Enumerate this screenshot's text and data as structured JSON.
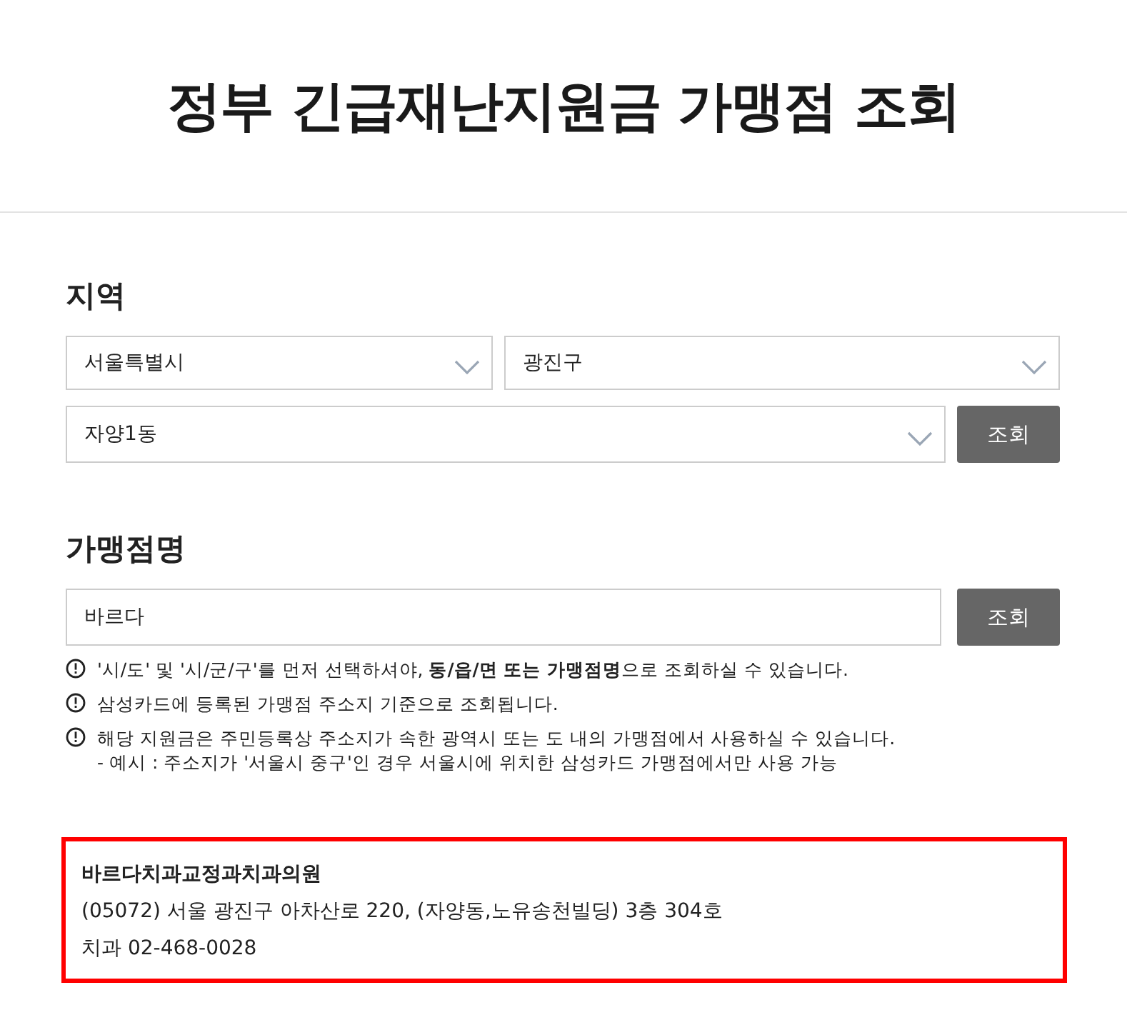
{
  "title": "정부 긴급재난지원금 가맹점 조회",
  "region": {
    "heading": "지역",
    "selects": [
      {
        "value": "서울특별시"
      },
      {
        "value": "광진구"
      },
      {
        "value": "자양1동"
      }
    ],
    "button": "조회"
  },
  "store": {
    "heading": "가맹점명",
    "value": "바르다",
    "button": "조회",
    "notes": [
      {
        "text": "'시/도' 및 '시/군/구'를 먼저 선택하셔야, **동/읍/면 또는 가맹점명**으로 조회하실 수 있습니다."
      },
      {
        "text": "삼성카드에 등록된 가맹점 주소지 기준으로 조회됩니다."
      },
      {
        "text": "해당 지원금은 주민등록상 주소지가 속한 광역시 또는 도 내의 가맹점에서 사용하실 수 있습니다.",
        "sub": "- 예시 : 주소지가 '서울시 중구'인 경우 서울시에 위치한 삼성카드 가맹점에서만 사용 가능"
      }
    ]
  },
  "results": [
    {
      "name": "바르다치과교정과치과의원",
      "address": "(05072) 서울 광진구 아차산로 220, (자양동,노유송천빌딩) 3층 304호",
      "phone": "치과 02-468-0028",
      "selected": true
    }
  ]
}
